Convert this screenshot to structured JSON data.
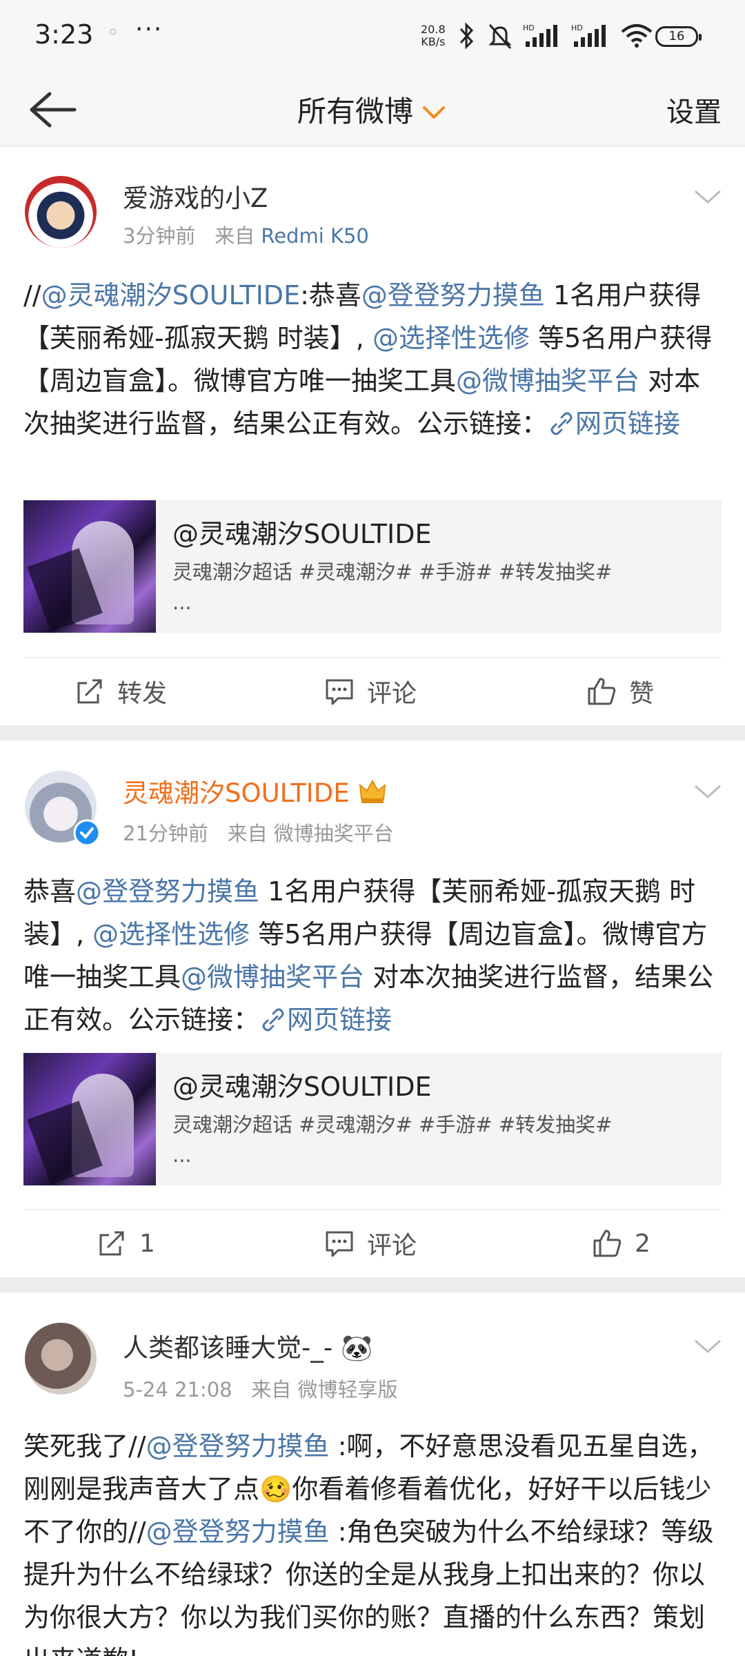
{
  "status_bar": {
    "time": "3:23",
    "dots": "◦",
    "more": "···",
    "speed_value": "20.8",
    "speed_unit": "KB/s",
    "battery": "16"
  },
  "nav": {
    "title": "所有微博",
    "chevron": "﹀",
    "settings": "设置"
  },
  "posts": [
    {
      "username": "爱游戏的小Z",
      "time": "3分钟前",
      "source_prefix": "来自",
      "source": "Redmi K50",
      "text": {
        "p1": "//",
        "at1": "@灵魂潮汐SOULTIDE",
        "p2": ":恭喜",
        "at2": "@登登努力摸鱼",
        "p3": " 1名用户获得【芙丽希娅-孤寂天鹅 时装】, ",
        "at3": "@选择性选修",
        "p4": " 等5名用户获得【周边盲盒】。微博官方唯一抽奖工具",
        "at4": "@微博抽奖平台",
        "p5": " 对本次抽奖进行监督，结果公正有效。公示链接：",
        "link": "网页链接"
      },
      "card_title": "@灵魂潮汐SOULTIDE",
      "card_desc": "灵魂潮汐超话 #灵魂潮汐# #手游# #转发抽奖#",
      "card_ellipsis": "...",
      "repost": "转发",
      "comment": "评论",
      "like": "赞"
    },
    {
      "username": "灵魂潮汐SOULTIDE",
      "time": "21分钟前",
      "source_prefix": "来自",
      "source": "微博抽奖平台",
      "text": {
        "p1": "恭喜",
        "at1": "@登登努力摸鱼",
        "p2": " 1名用户获得【芙丽希娅-孤寂天鹅 时装】, ",
        "at2": "@选择性选修",
        "p3": " 等5名用户获得【周边盲盒】。微博官方唯一抽奖工具",
        "at3": "@微博抽奖平台",
        "p4": " 对本次抽奖进行监督，结果公正有效。公示链接：",
        "link": "网页链接"
      },
      "card_title": "@灵魂潮汐SOULTIDE",
      "card_desc": "灵魂潮汐超话 #灵魂潮汐# #手游# #转发抽奖#",
      "card_ellipsis": "...",
      "repost": "1",
      "comment": "评论",
      "like": "2"
    },
    {
      "username": "人类都该睡大觉-_-",
      "user_emoji": "🐼",
      "time": "5-24 21:08",
      "source_prefix": "来自",
      "source": "微博轻享版",
      "text": {
        "p1": "笑死我了//",
        "at1": "@登登努力摸鱼",
        "p2": " :啊，不好意思没看见五星自选，刚刚是我声音大了点",
        "emoji": "🥴",
        "p3": "你看着修看着优化，好好干以后钱少不了你的//",
        "at2": "@登登努力摸鱼",
        "p4": " :角色突破为什么不给绿球？等级提升为什么不给绿球？你送的全是从我身上扣出来的？你以为你很大方？你以为我们买你的账？直播的什么东西？策划出来道歉!"
      }
    }
  ],
  "colors": {
    "link_blue": "#4a76a8",
    "orange_name": "#f26e1a",
    "verified_blue": "#1f8ef1"
  }
}
